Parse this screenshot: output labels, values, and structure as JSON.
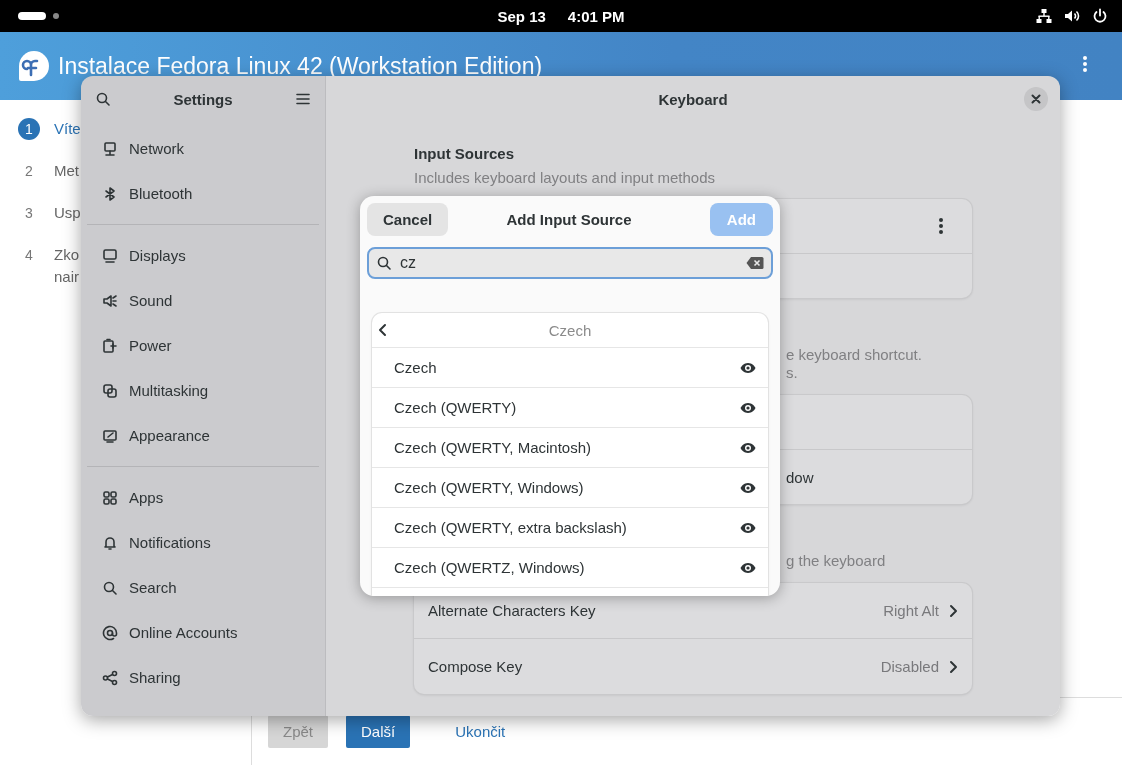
{
  "top_bar": {
    "date": "Sep 13",
    "time": "4:01 PM"
  },
  "installer": {
    "title": "Instalace Fedora Linux 42 (Workstation Edition)",
    "steps": [
      {
        "number": "1",
        "lines": [
          "Víte"
        ],
        "selected": true
      },
      {
        "number": "2",
        "lines": [
          "Met"
        ],
        "selected": false
      },
      {
        "number": "3",
        "lines": [
          "Usp"
        ],
        "selected": false
      },
      {
        "number": "4",
        "lines": [
          "Zko",
          "nair"
        ],
        "selected": false
      }
    ],
    "buttons": [
      {
        "label": "Zpět",
        "kind": "disabled"
      },
      {
        "label": "Další",
        "kind": "primary"
      },
      {
        "label": "Ukončit",
        "kind": "link"
      }
    ]
  },
  "settings": {
    "title": "Settings",
    "sidebar_groups": [
      [
        {
          "label": "Network"
        },
        {
          "label": "Bluetooth"
        }
      ],
      [
        {
          "label": "Displays"
        },
        {
          "label": "Sound"
        },
        {
          "label": "Power"
        },
        {
          "label": "Multitasking"
        },
        {
          "label": "Appearance"
        }
      ],
      [
        {
          "label": "Apps"
        },
        {
          "label": "Notifications"
        },
        {
          "label": "Search"
        },
        {
          "label": "Online Accounts"
        },
        {
          "label": "Sharing"
        }
      ]
    ],
    "page_title": "Keyboard",
    "input_sources": {
      "title": "Input Sources",
      "subtitle": "Includes keyboard layouts and input methods"
    },
    "switching_hint_lines": [
      "e keyboard shortcut.",
      "s."
    ],
    "switching_row_2": "dow",
    "special_hint": "g the keyboard",
    "special_rows": [
      {
        "label": "Alternate Characters Key",
        "value": "Right Alt"
      },
      {
        "label": "Compose Key",
        "value": "Disabled"
      }
    ]
  },
  "dialog": {
    "title": "Add Input Source",
    "cancel": "Cancel",
    "add": "Add",
    "add_disabled": true,
    "search": {
      "value": "cz"
    },
    "list_header": "Czech",
    "rows": [
      "Czech",
      "Czech (QWERTY)",
      "Czech (QWERTY, Macintosh)",
      "Czech (QWERTY, Windows)",
      "Czech (QWERTY, extra backslash)",
      "Czech (QWERTZ, Windows)"
    ]
  }
}
